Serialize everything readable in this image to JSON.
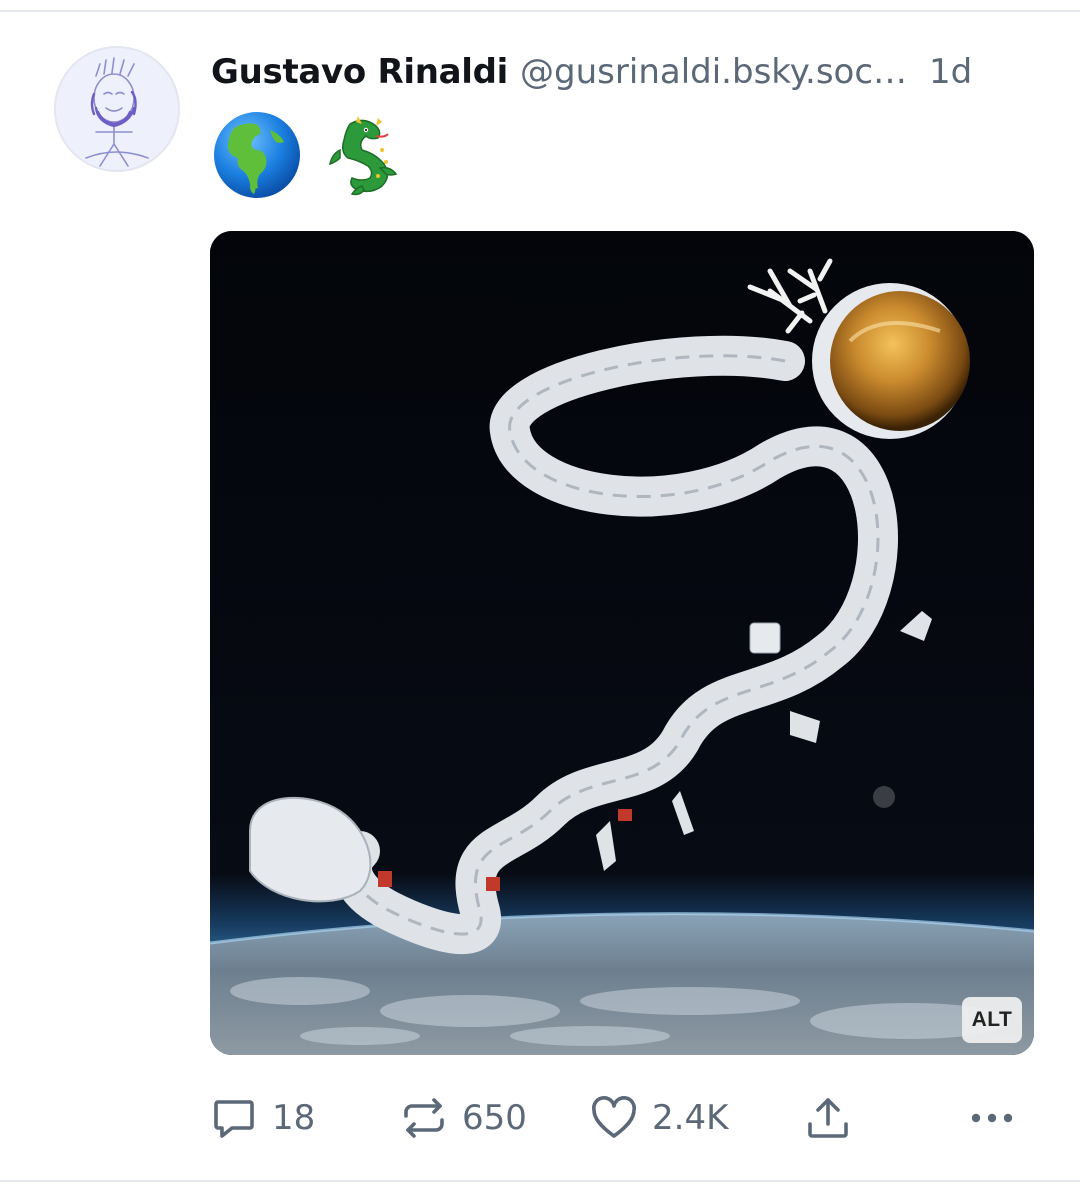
{
  "post": {
    "author_name": "Gustavo Rinaldi",
    "author_handle": "@gusrinaldi.bsky.soc…",
    "time_ago": "1d",
    "emojis": [
      "globe-americas-emoji",
      "dragon-emoji"
    ],
    "image": {
      "alt_badge": "ALT"
    }
  },
  "actions": {
    "reply": {
      "icon": "reply-icon",
      "count": "18"
    },
    "repost": {
      "icon": "repost-icon",
      "count": "650"
    },
    "like": {
      "icon": "heart-icon",
      "count": "2.4K"
    },
    "share": {
      "icon": "share-icon"
    },
    "more": {
      "icon": "more-icon"
    }
  },
  "colors": {
    "name": "#111418",
    "muted": "#5b6878",
    "image_bg": "#05070b",
    "helmet_gold": "#c98a2e"
  }
}
